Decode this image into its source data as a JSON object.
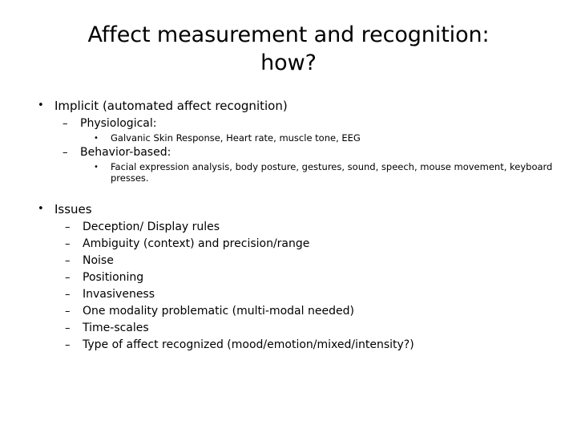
{
  "slide": {
    "title": "Affect measurement and recognition: how?",
    "title_lines": [
      "Affect measurement and recognition:",
      "how?"
    ],
    "background_color": "#FFFFFF",
    "text_color": "#000000",
    "markers": {
      "level1": "•",
      "level2": "–",
      "level3": "•"
    },
    "sections": [
      {
        "heading": "Implicit (automated affect recognition)",
        "groups": [
          {
            "label": "Physiological:",
            "details": [
              "Galvanic Skin Response, Heart rate, muscle tone, EEG"
            ]
          },
          {
            "label": "Behavior-based:",
            "details": [
              "Facial expression analysis, body posture, gestures, sound, speech, mouse movement, keyboard presses."
            ]
          }
        ]
      },
      {
        "heading": "Issues",
        "items": [
          "Deception/ Display rules",
          "Ambiguity (context) and precision/range",
          "Noise",
          "Positioning",
          "Invasiveness",
          "One modality problematic (multi-modal needed)",
          "Time-scales",
          "Type of affect recognized (mood/emotion/mixed/intensity?)"
        ]
      }
    ]
  }
}
